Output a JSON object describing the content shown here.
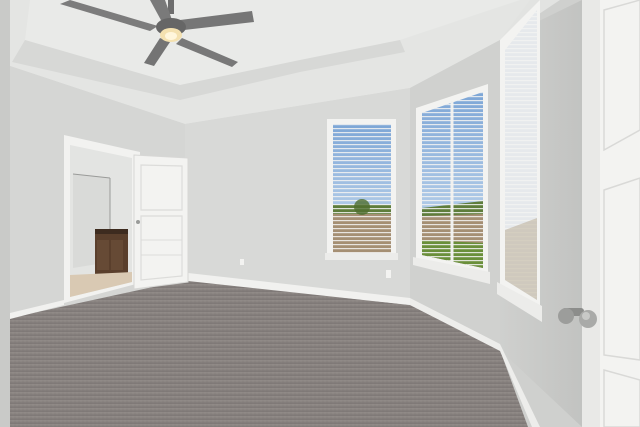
{
  "scene": {
    "kind": "empty-bedroom-photo",
    "colors": {
      "wall": "#d6d7d5",
      "wall_shadow": "#c4c5c3",
      "ceiling": "#e4e5e3",
      "carpet": "#8a8583",
      "trim": "#f1f1ef",
      "door": "#f3f3f1",
      "sky": "#8fb4dc",
      "grass": "#6a8f3a",
      "fence": "#a58f73",
      "vanity": "#5a3f2c"
    },
    "icons": [
      "ceiling-fan-icon",
      "door-knob-icon"
    ]
  }
}
